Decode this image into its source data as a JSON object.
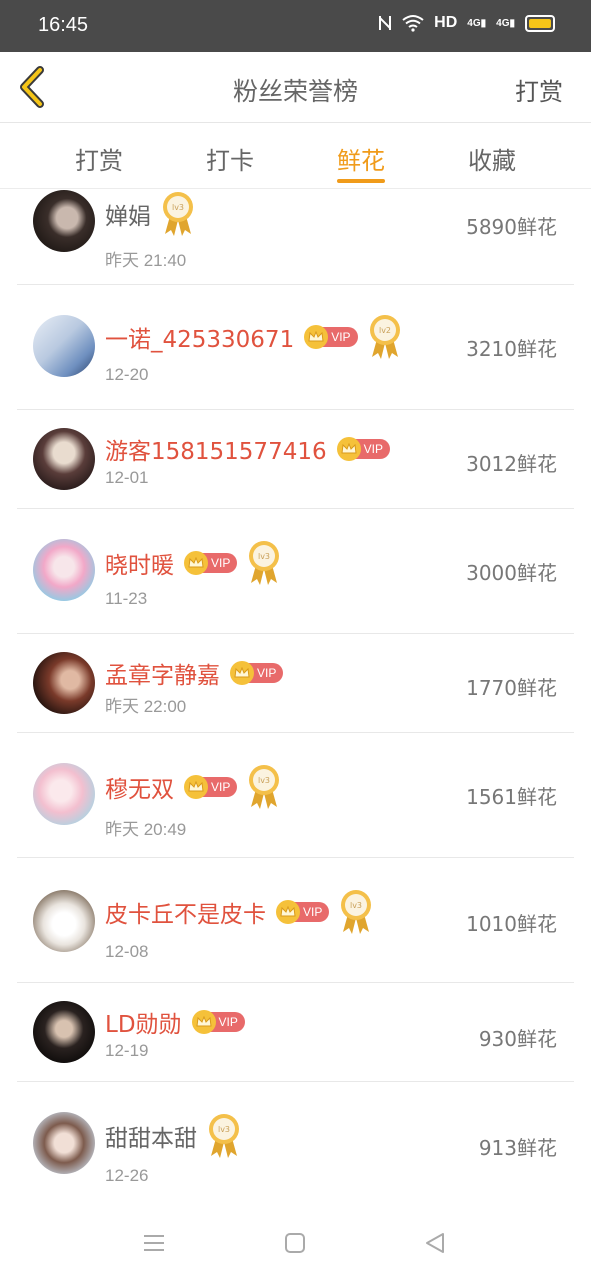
{
  "status_bar": {
    "time": "16:45",
    "network": "HD",
    "signal1": "4G",
    "signal2": "4G"
  },
  "header": {
    "title": "粉丝荣誉榜",
    "right_action": "打赏"
  },
  "tabs": [
    {
      "label": "打赏",
      "active": false
    },
    {
      "label": "打卡",
      "active": false
    },
    {
      "label": "鲜花",
      "active": true
    },
    {
      "label": "收藏",
      "active": false
    }
  ],
  "colors": {
    "accent": "#f09b1a",
    "vip_name": "#e0523e",
    "vip_tag": "#e86a6a",
    "crown": "#f5c13a"
  },
  "fans": [
    {
      "name": "婵娟",
      "vip": false,
      "level": "lv3",
      "date": "昨天 21:40",
      "amount": "5890鲜花",
      "vip_label": ""
    },
    {
      "name": "一诺_425330671",
      "vip": true,
      "level": "lv2",
      "date": "12-20",
      "amount": "3210鲜花",
      "vip_label": "VIP"
    },
    {
      "name": "游客158151577416",
      "vip": true,
      "level": "",
      "date": "12-01",
      "amount": "3012鲜花",
      "vip_label": "VIP"
    },
    {
      "name": "晓时暖",
      "vip": true,
      "level": "lv3",
      "date": "11-23",
      "amount": "3000鲜花",
      "vip_label": "VIP"
    },
    {
      "name": "孟章字静嘉",
      "vip": true,
      "level": "",
      "date": "昨天 22:00",
      "amount": "1770鲜花",
      "vip_label": "VIP"
    },
    {
      "name": "穆无双",
      "vip": true,
      "level": "lv3",
      "date": "昨天 20:49",
      "amount": "1561鲜花",
      "vip_label": "VIP"
    },
    {
      "name": "皮卡丘不是皮卡",
      "vip": true,
      "level": "lv3",
      "date": "12-08",
      "amount": "1010鲜花",
      "vip_label": "VIP"
    },
    {
      "name": "LD勋勋",
      "vip": true,
      "level": "",
      "date": "12-19",
      "amount": "930鲜花",
      "vip_label": "VIP"
    },
    {
      "name": "甜甜本甜",
      "vip": false,
      "level": "lv3",
      "date": "12-26",
      "amount": "913鲜花",
      "vip_label": ""
    }
  ]
}
